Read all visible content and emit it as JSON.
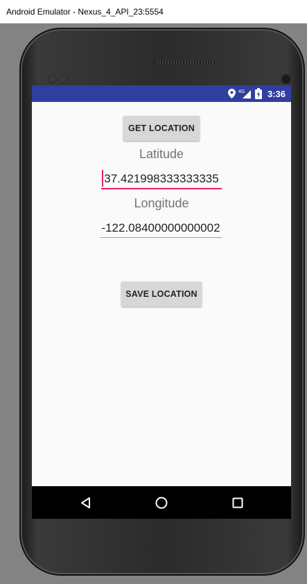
{
  "window": {
    "title": "Android Emulator - Nexus_4_API_23:5554"
  },
  "status_bar": {
    "time": "3:36",
    "network": "4G",
    "icons": [
      "location-icon",
      "signal-4g-icon",
      "battery-charging-icon"
    ],
    "color": "#303f9f"
  },
  "app": {
    "get_location_label": "GET LOCATION",
    "latitude_label": "Latitude",
    "latitude_value": "37.421998333333335",
    "longitude_label": "Longitude",
    "longitude_value": "-122.08400000000002",
    "save_location_label": "SAVE LOCATION",
    "accent_color": "#e91e63"
  },
  "nav_bar": {
    "buttons": [
      "back-icon",
      "home-icon",
      "recents-icon"
    ]
  }
}
